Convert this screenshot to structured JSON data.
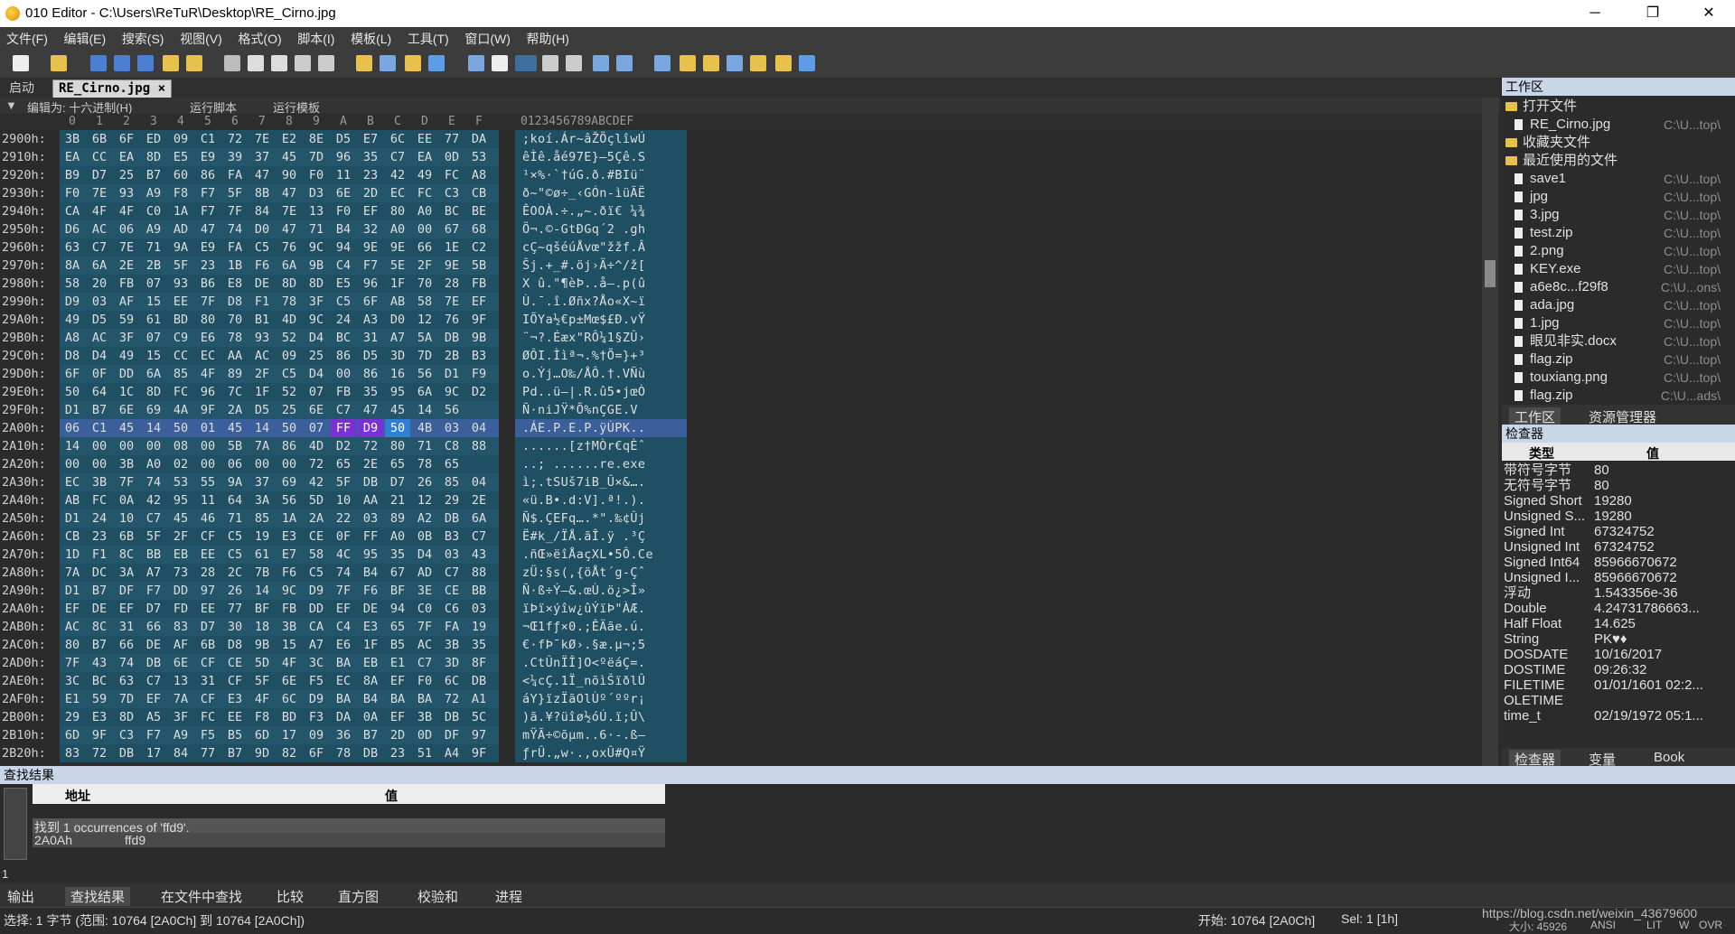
{
  "window": {
    "title": "010 Editor - C:\\Users\\ReTuR\\Desktop\\RE_Cirno.jpg",
    "minimize": "─",
    "maximize": "❐",
    "close": "✕"
  },
  "menu": [
    "文件(F)",
    "编辑(E)",
    "搜索(S)",
    "视图(V)",
    "格式(O)",
    "脚本(I)",
    "模板(L)",
    "工具(T)",
    "窗口(W)",
    "帮助(H)"
  ],
  "tabs": {
    "start": "启动",
    "active": "RE_Cirno.jpg",
    "active_close": "×"
  },
  "editbar": {
    "edit_as": "编辑为: 十六进制(H)",
    "run_script": "运行脚本",
    "run_template": "运行模板"
  },
  "hex_header": {
    "columns": [
      "0",
      "1",
      "2",
      "3",
      "4",
      "5",
      "6",
      "7",
      "8",
      "9",
      "A",
      "B",
      "C",
      "D",
      "E",
      "F"
    ],
    "ascii": "0123456789ABCDEF"
  },
  "hex_rows": [
    {
      "addr": "2900h:",
      "bytes": [
        "3B",
        "6B",
        "6F",
        "ED",
        "09",
        "C1",
        "72",
        "7E",
        "E2",
        "8E",
        "D5",
        "E7",
        "6C",
        "EE",
        "77",
        "DA"
      ],
      "ascii": ";koí.Ár~âŽÕçlîwÚ"
    },
    {
      "addr": "2910h:",
      "bytes": [
        "EA",
        "CC",
        "EA",
        "8D",
        "E5",
        "E9",
        "39",
        "37",
        "45",
        "7D",
        "96",
        "35",
        "C7",
        "EA",
        "0D",
        "53"
      ],
      "ascii": "êÌê.åé97E}–5Çê.S"
    },
    {
      "addr": "2920h:",
      "bytes": [
        "B9",
        "D7",
        "25",
        "B7",
        "60",
        "86",
        "FA",
        "47",
        "90",
        "F0",
        "11",
        "23",
        "42",
        "49",
        "FC",
        "A8"
      ],
      "ascii": "¹×%·`†úG.ð.#BIü¨"
    },
    {
      "addr": "2930h:",
      "bytes": [
        "F0",
        "7E",
        "93",
        "A9",
        "F8",
        "F7",
        "5F",
        "8B",
        "47",
        "D3",
        "6E",
        "2D",
        "EC",
        "FC",
        "C3",
        "CB"
      ],
      "ascii": "ð~\"©ø÷_‹GÓn-ìüÃË"
    },
    {
      "addr": "2940h:",
      "bytes": [
        "CA",
        "4F",
        "4F",
        "C0",
        "1A",
        "F7",
        "7F",
        "84",
        "7E",
        "13",
        "F0",
        "EF",
        "80",
        "A0",
        "BC",
        "BE"
      ],
      "ascii": "ÊOOÀ.÷.„~.ðï€ ¼¾"
    },
    {
      "addr": "2950h:",
      "bytes": [
        "D6",
        "AC",
        "06",
        "A9",
        "AD",
        "47",
        "74",
        "D0",
        "47",
        "71",
        "B4",
        "32",
        "A0",
        "00",
        "67",
        "68"
      ],
      "ascii": "Ö¬.©-GtÐGq´2 .gh"
    },
    {
      "addr": "2960h:",
      "bytes": [
        "63",
        "C7",
        "7E",
        "71",
        "9A",
        "E9",
        "FA",
        "C5",
        "76",
        "9C",
        "94",
        "9E",
        "9E",
        "66",
        "1E",
        "C2"
      ],
      "ascii": "cÇ~qšéúÅvœ\"žžf.Â"
    },
    {
      "addr": "2970h:",
      "bytes": [
        "8A",
        "6A",
        "2E",
        "2B",
        "5F",
        "23",
        "1B",
        "F6",
        "6A",
        "9B",
        "C4",
        "F7",
        "5E",
        "2F",
        "9E",
        "5B"
      ],
      "ascii": "Šj.+_#.öj›Ä÷^/ž["
    },
    {
      "addr": "2980h:",
      "bytes": [
        "58",
        "20",
        "FB",
        "07",
        "93",
        "B6",
        "E8",
        "DE",
        "8D",
        "8D",
        "E5",
        "96",
        "1F",
        "70",
        "28",
        "FB"
      ],
      "ascii": "X û.\"¶èÞ..å–.p(û"
    },
    {
      "addr": "2990h:",
      "bytes": [
        "D9",
        "03",
        "AF",
        "15",
        "EE",
        "7F",
        "D8",
        "F1",
        "78",
        "3F",
        "C5",
        "6F",
        "AB",
        "58",
        "7E",
        "EF"
      ],
      "ascii": "Ù.¯.î.Øñx?Åo«X~ï"
    },
    {
      "addr": "29A0h:",
      "bytes": [
        "49",
        "D5",
        "59",
        "61",
        "BD",
        "80",
        "70",
        "B1",
        "4D",
        "9C",
        "24",
        "A3",
        "D0",
        "12",
        "76",
        "9F"
      ],
      "ascii": "IÕYa½€p±Mœ$£Ð.vŸ"
    },
    {
      "addr": "29B0h:",
      "bytes": [
        "A8",
        "AC",
        "3F",
        "07",
        "C9",
        "E6",
        "78",
        "93",
        "52",
        "D4",
        "BC",
        "31",
        "A7",
        "5A",
        "DB",
        "9B"
      ],
      "ascii": "¨¬?.Éæx\"RÔ¼1§ZÛ›"
    },
    {
      "addr": "29C0h:",
      "bytes": [
        "D8",
        "D4",
        "49",
        "15",
        "CC",
        "EC",
        "AA",
        "AC",
        "09",
        "25",
        "86",
        "D5",
        "3D",
        "7D",
        "2B",
        "B3"
      ],
      "ascii": "ØÔI.Ììª¬.%†Õ=}+³"
    },
    {
      "addr": "29D0h:",
      "bytes": [
        "6F",
        "0F",
        "DD",
        "6A",
        "85",
        "4F",
        "89",
        "2F",
        "C5",
        "D4",
        "00",
        "86",
        "16",
        "56",
        "D1",
        "F9"
      ],
      "ascii": "o.Ýj…O‰/ÅÔ.†.VÑù"
    },
    {
      "addr": "29E0h:",
      "bytes": [
        "50",
        "64",
        "1C",
        "8D",
        "FC",
        "96",
        "7C",
        "1F",
        "52",
        "07",
        "FB",
        "35",
        "95",
        "6A",
        "9C",
        "D2"
      ],
      "ascii": "Pd..ü–|.R.û5•jœÒ"
    },
    {
      "addr": "29F0h:",
      "bytes": [
        "D1",
        "B7",
        "6E",
        "69",
        "4A",
        "9F",
        "2A",
        "D5",
        "25",
        "6E",
        "C7",
        "47",
        "45",
        "14",
        "56"
      ],
      "ascii": "Ñ·niJŸ*Õ%nÇGE.V"
    },
    {
      "addr": "2A00h:",
      "bytes": [
        "06",
        "C1",
        "45",
        "14",
        "50",
        "01",
        "45",
        "14",
        "50",
        "07",
        "FF",
        "D9",
        "50",
        "4B",
        "03",
        "04"
      ],
      "ascii": ".ÁE.P.E.P.ÿÙPK..",
      "selected": true
    },
    {
      "addr": "2A10h:",
      "bytes": [
        "14",
        "00",
        "00",
        "00",
        "08",
        "00",
        "5B",
        "7A",
        "86",
        "4D",
        "D2",
        "72",
        "80",
        "71",
        "C8",
        "88"
      ],
      "ascii": "......[z†MÒr€qÈˆ"
    },
    {
      "addr": "2A20h:",
      "bytes": [
        "00",
        "00",
        "3B",
        "A0",
        "02",
        "00",
        "06",
        "00",
        "00",
        "72",
        "65",
        "2E",
        "65",
        "78",
        "65"
      ],
      "ascii": "..; ......re.exe"
    },
    {
      "addr": "2A30h:",
      "bytes": [
        "EC",
        "3B",
        "7F",
        "74",
        "53",
        "55",
        "9A",
        "37",
        "69",
        "42",
        "5F",
        "DB",
        "D7",
        "26",
        "85",
        "04"
      ],
      "ascii": "ì;.tSUš7iB_Û×&…."
    },
    {
      "addr": "2A40h:",
      "bytes": [
        "AB",
        "FC",
        "0A",
        "42",
        "95",
        "11",
        "64",
        "3A",
        "56",
        "5D",
        "10",
        "AA",
        "21",
        "12",
        "29",
        "2E"
      ],
      "ascii": "«ü.B•.d:V].ª!.)."
    },
    {
      "addr": "2A50h:",
      "bytes": [
        "D1",
        "24",
        "10",
        "C7",
        "45",
        "46",
        "71",
        "85",
        "1A",
        "2A",
        "22",
        "03",
        "89",
        "A2",
        "DB",
        "6A"
      ],
      "ascii": "Ñ$.ÇEFq….*\".‰¢Ûj"
    },
    {
      "addr": "2A60h:",
      "bytes": [
        "CB",
        "23",
        "6B",
        "5F",
        "2F",
        "CF",
        "C5",
        "19",
        "E3",
        "CE",
        "0F",
        "FF",
        "A0",
        "0B",
        "B3",
        "C7"
      ],
      "ascii": "Ë#k_/ÏÅ.ãÎ.ÿ .³Ç"
    },
    {
      "addr": "2A70h:",
      "bytes": [
        "1D",
        "F1",
        "8C",
        "BB",
        "EB",
        "EE",
        "C5",
        "61",
        "E7",
        "58",
        "4C",
        "95",
        "35",
        "D4",
        "03",
        "43",
        "65"
      ],
      "ascii": ".ñŒ»ëîÅaçXL•5Ô.Ce"
    },
    {
      "addr": "2A80h:",
      "bytes": [
        "7A",
        "DC",
        "3A",
        "A7",
        "73",
        "28",
        "2C",
        "7B",
        "F6",
        "C5",
        "74",
        "B4",
        "67",
        "AD",
        "C7",
        "88"
      ],
      "ascii": "zÜ:§s(,{öÅt´g-Çˆ"
    },
    {
      "addr": "2A90h:",
      "bytes": [
        "D1",
        "B7",
        "DF",
        "F7",
        "DD",
        "97",
        "26",
        "14",
        "9C",
        "D9",
        "7F",
        "F6",
        "BF",
        "3E",
        "CE",
        "BB"
      ],
      "ascii": "Ñ·ß÷Ý—&.œÙ.ö¿>Î»"
    },
    {
      "addr": "2AA0h:",
      "bytes": [
        "EF",
        "DE",
        "EF",
        "D7",
        "FD",
        "EE",
        "77",
        "BF",
        "FB",
        "DD",
        "EF",
        "DE",
        "94",
        "C0",
        "C6",
        "03"
      ],
      "ascii": "ïÞï×ýîw¿ûÝïÞ\"ÀÆ."
    },
    {
      "addr": "2AB0h:",
      "bytes": [
        "AC",
        "8C",
        "31",
        "66",
        "83",
        "D7",
        "30",
        "18",
        "3B",
        "CA",
        "C4",
        "E3",
        "65",
        "7F",
        "FA",
        "19"
      ],
      "ascii": "¬Œ1fƒ×0.;ÊÄãe.ú."
    },
    {
      "addr": "2AC0h:",
      "bytes": [
        "80",
        "B7",
        "66",
        "DE",
        "AF",
        "6B",
        "D8",
        "9B",
        "15",
        "A7",
        "E6",
        "1F",
        "B5",
        "AC",
        "3B",
        "35"
      ],
      "ascii": "€·fÞ¯kØ›.§æ.µ¬;5"
    },
    {
      "addr": "2AD0h:",
      "bytes": [
        "7F",
        "43",
        "74",
        "DB",
        "6E",
        "CF",
        "CE",
        "5D",
        "4F",
        "3C",
        "BA",
        "EB",
        "E1",
        "C7",
        "3D",
        "8F"
      ],
      "ascii": ".CtÛnÏÎ]O<ºëáÇ=."
    },
    {
      "addr": "2AE0h:",
      "bytes": [
        "3C",
        "BC",
        "63",
        "C7",
        "13",
        "31",
        "CF",
        "5F",
        "6E",
        "F5",
        "EC",
        "8A",
        "EF",
        "F0",
        "6C",
        "DB"
      ],
      "ascii": "<¼cÇ.1Ï_nõìŠïðlÛ"
    },
    {
      "addr": "2AF0h:",
      "bytes": [
        "E1",
        "59",
        "7D",
        "EF",
        "7A",
        "CF",
        "E3",
        "4F",
        "6C",
        "D9",
        "BA",
        "B4",
        "BA",
        "BA",
        "72",
        "A1"
      ],
      "ascii": "áY}ïzÏãOlÙº´ººr¡"
    },
    {
      "addr": "2B00h:",
      "bytes": [
        "29",
        "E3",
        "8D",
        "A5",
        "3F",
        "FC",
        "EE",
        "F8",
        "BD",
        "F3",
        "DA",
        "0A",
        "EF",
        "3B",
        "DB",
        "5C"
      ],
      "ascii": ")ã.¥?üîø½óÚ.ï;Û\\"
    },
    {
      "addr": "2B10h:",
      "bytes": [
        "6D",
        "9F",
        "C3",
        "F7",
        "A9",
        "F5",
        "B5",
        "6D",
        "17",
        "09",
        "36",
        "B7",
        "2D",
        "0D",
        "DF",
        "97"
      ],
      "ascii": "mŸÃ÷©õµm..6·-.ß—"
    },
    {
      "addr": "2B20h:",
      "bytes": [
        "83",
        "72",
        "DB",
        "17",
        "84",
        "77",
        "B7",
        "9D",
        "82",
        "6F",
        "78",
        "DB",
        "23",
        "51",
        "A4",
        "9F"
      ],
      "ascii": "ƒrÛ.„w·.‚oxÛ#Q¤Ÿ"
    }
  ],
  "workspace": {
    "title": "工作区",
    "open_files": "打开文件",
    "open_items": [
      {
        "name": "RE_Cirno.jpg",
        "path": "C:\\U...top\\"
      }
    ],
    "favorites": "收藏夹文件",
    "recent": "最近使用的文件",
    "recent_items": [
      {
        "name": "save1",
        "path": "C:\\U...top\\"
      },
      {
        "name": "jpg",
        "path": "C:\\U...top\\"
      },
      {
        "name": "3.jpg",
        "path": "C:\\U...top\\"
      },
      {
        "name": "test.zip",
        "path": "C:\\U...top\\"
      },
      {
        "name": "2.png",
        "path": "C:\\U...top\\"
      },
      {
        "name": "KEY.exe",
        "path": "C:\\U...top\\"
      },
      {
        "name": "a6e8c...f29f8",
        "path": "C:\\U...ons\\"
      },
      {
        "name": "ada.jpg",
        "path": "C:\\U...top\\"
      },
      {
        "name": "1.jpg",
        "path": "C:\\U...top\\"
      },
      {
        "name": "眼见非实.docx",
        "path": "C:\\U...top\\"
      },
      {
        "name": "flag.zip",
        "path": "C:\\U...top\\"
      },
      {
        "name": "touxiang.png",
        "path": "C:\\U...top\\"
      },
      {
        "name": "flag.zip",
        "path": "C:\\U...ads\\"
      }
    ],
    "tab_workspace": "工作区",
    "tab_explorer": "资源管理器"
  },
  "inspector": {
    "title": "检查器",
    "col_type": "类型",
    "col_value": "值",
    "rows": [
      {
        "type": "带符号字节",
        "value": "80"
      },
      {
        "type": "无符号字节",
        "value": "80"
      },
      {
        "type": "Signed Short",
        "value": "19280"
      },
      {
        "type": "Unsigned S...",
        "value": "19280"
      },
      {
        "type": "Signed Int",
        "value": "67324752"
      },
      {
        "type": "Unsigned Int",
        "value": "67324752"
      },
      {
        "type": "Signed Int64",
        "value": "85966670672"
      },
      {
        "type": "Unsigned I...",
        "value": "85966670672"
      },
      {
        "type": "浮动",
        "value": "1.543356e-36"
      },
      {
        "type": "Double",
        "value": "4.24731786663..."
      },
      {
        "type": "Half Float",
        "value": "14.625"
      },
      {
        "type": "String",
        "value": "PK♥♦"
      },
      {
        "type": "DOSDATE",
        "value": "10/16/2017"
      },
      {
        "type": "DOSTIME",
        "value": "09:26:32"
      },
      {
        "type": "FILETIME",
        "value": "01/01/1601 02:2..."
      },
      {
        "type": "OLETIME",
        "value": ""
      },
      {
        "type": "time_t",
        "value": "02/19/1972 05:1..."
      }
    ],
    "tab_inspector": "检查器",
    "tab_vars": "变量",
    "tab_book": "Book"
  },
  "find": {
    "title": "查找结果",
    "col_addr": "地址",
    "col_value": "值",
    "summary": "找到 1 occurrences of 'ffd9'.",
    "result_addr": "2A0Ah",
    "result_value": "ffd9",
    "line_no": "1"
  },
  "bottom_tabs": [
    "输出",
    "查找结果",
    "在文件中查找",
    "比较",
    "直方图",
    "校验和",
    "进程"
  ],
  "status": {
    "selection": "选择: 1 字节 (范围: 10764 [2A0Ch] 到 10764 [2A0Ch])",
    "start": "开始: 10764 [2A0Ch]",
    "sel": "Sel: 1 [1h]",
    "url": "https://blog.csdn.net/weixin_43679600",
    "size": "大小: 45926",
    "encoding": "ANSI",
    "lit": "LIT",
    "w": "W",
    "ovr": "OVR"
  }
}
